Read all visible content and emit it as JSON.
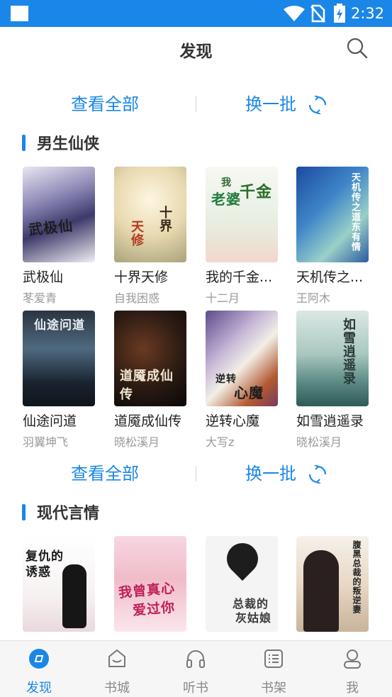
{
  "status_bar": {
    "time": "2:32"
  },
  "header": {
    "title": "发现"
  },
  "actions": {
    "view_all": "查看全部",
    "swap": "换一批"
  },
  "sections": [
    {
      "title": "男生仙侠",
      "books": [
        {
          "name": "武极仙",
          "author": "苳爱青"
        },
        {
          "name": "十界天修",
          "author": "自我困惑"
        },
        {
          "name": "我的千金...",
          "author": "十二月"
        },
        {
          "name": "天机传之...",
          "author": "王阿木"
        },
        {
          "name": "仙途问道",
          "author": "羽翼坤飞"
        },
        {
          "name": "道魇成仙传",
          "author": "晓松溪月"
        },
        {
          "name": "逆转心魔",
          "author": "大写z"
        },
        {
          "name": "如雪逍遥录",
          "author": "晓松溪月"
        }
      ]
    },
    {
      "title": "现代言情",
      "books": [
        {
          "name": "",
          "author": ""
        },
        {
          "name": "",
          "author": ""
        },
        {
          "name": "",
          "author": ""
        },
        {
          "name": "",
          "author": ""
        }
      ]
    }
  ],
  "covers": {
    "c1": "武极仙",
    "c2a": "十界",
    "c2b": "天修",
    "c3a": "我",
    "c3b": "老婆",
    "c3c": "千金",
    "c4": "天机传之道东有情",
    "c5": "仙途问道",
    "c6": "道魇成仙传",
    "c7a": "逆转",
    "c7b": "心魔",
    "c8": "如雪逍遥录",
    "c9": "复仇的诱惑",
    "c10a": "我曾真心",
    "c10b": "爱过你",
    "c11a": "总裁的",
    "c11b": "灰姑娘",
    "c12": "腹黑总裁的叛逆妻"
  },
  "bottom_nav": [
    {
      "label": "发现",
      "icon": "discover-icon",
      "active": true
    },
    {
      "label": "书城",
      "icon": "bookstore-icon",
      "active": false
    },
    {
      "label": "听书",
      "icon": "headphones-icon",
      "active": false
    },
    {
      "label": "书架",
      "icon": "bookshelf-icon",
      "active": false
    },
    {
      "label": "我",
      "icon": "profile-icon",
      "active": false
    }
  ],
  "colors": {
    "accent": "#1a86e8",
    "muted": "#999999"
  }
}
